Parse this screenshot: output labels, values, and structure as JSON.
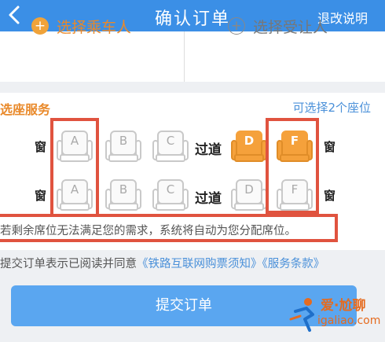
{
  "header": {
    "title": "确认订单",
    "help_label": "退改说明"
  },
  "passenger": {
    "select_passenger": "选择乘车人",
    "select_beneficiary": "选择受让人"
  },
  "seat_service": {
    "title": "选座服务",
    "hint": "可选择2个座位",
    "window_label": "窗",
    "aisle_label": "过道",
    "rows": [
      {
        "seats": [
          {
            "label": "A",
            "state": "available"
          },
          {
            "label": "B",
            "state": "available"
          },
          {
            "label": "C",
            "state": "available"
          },
          {
            "label": "D",
            "state": "selected"
          },
          {
            "label": "F",
            "state": "selected"
          }
        ]
      },
      {
        "seats": [
          {
            "label": "A",
            "state": "available"
          },
          {
            "label": "B",
            "state": "available"
          },
          {
            "label": "C",
            "state": "available"
          },
          {
            "label": "D",
            "state": "available"
          },
          {
            "label": "F",
            "state": "available"
          }
        ]
      }
    ]
  },
  "notice": "若剩余席位无法满足您的需求，系统将自动为您分配席位。",
  "agreement": {
    "prefix": "提交订单表示已阅读并同意",
    "link1": "《铁路互联网购票须知》",
    "link2": "《服务条款》"
  },
  "submit_label": "提交订单",
  "watermark": {
    "text": "爱·尬聊",
    "url": "igaliao.com"
  },
  "colors": {
    "brand_blue": "#3b8fe6",
    "accent_orange": "#f5a13b",
    "highlight_red": "#e0533f"
  }
}
